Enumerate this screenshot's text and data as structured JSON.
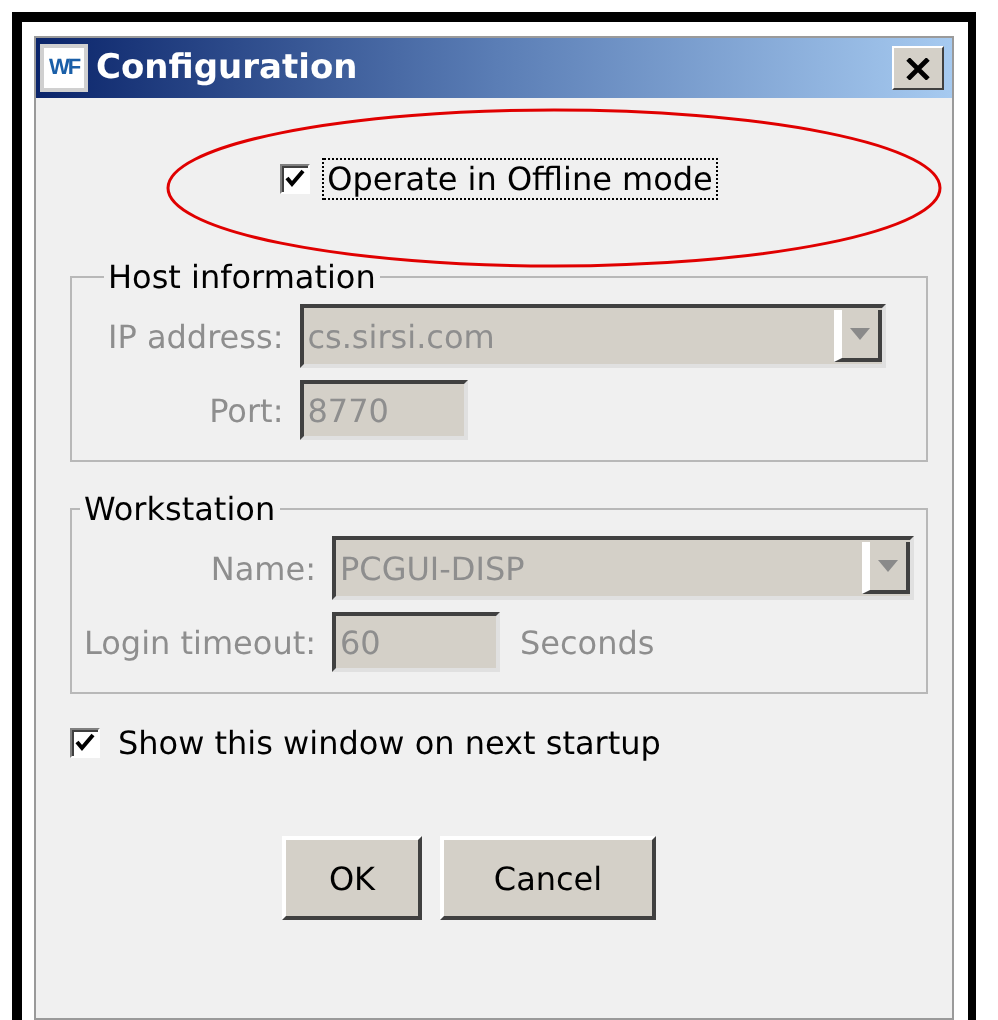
{
  "window": {
    "title": "Configuration",
    "app_icon": "WF"
  },
  "offline_mode": {
    "label": "Operate in Offline mode",
    "checked": true,
    "focused": true
  },
  "groups": [
    {
      "title": "Host information",
      "fields": [
        {
          "kind": "dropdown",
          "label": "IP address:",
          "value": "cs.sirsi.com",
          "disabled": true
        },
        {
          "kind": "text",
          "label": "Port:",
          "value": "8770",
          "disabled": true
        }
      ]
    },
    {
      "title": "Workstation",
      "fields": [
        {
          "kind": "dropdown",
          "label": "Name:",
          "value": "PCGUI-DISP",
          "disabled": true
        },
        {
          "kind": "text",
          "label": "Login timeout:",
          "value": "60",
          "unit": "Seconds",
          "disabled": true
        }
      ]
    }
  ],
  "show_on_startup": {
    "label": "Show this window on next startup",
    "checked": true,
    "focused": false
  },
  "buttons": [
    "OK",
    "Cancel"
  ]
}
